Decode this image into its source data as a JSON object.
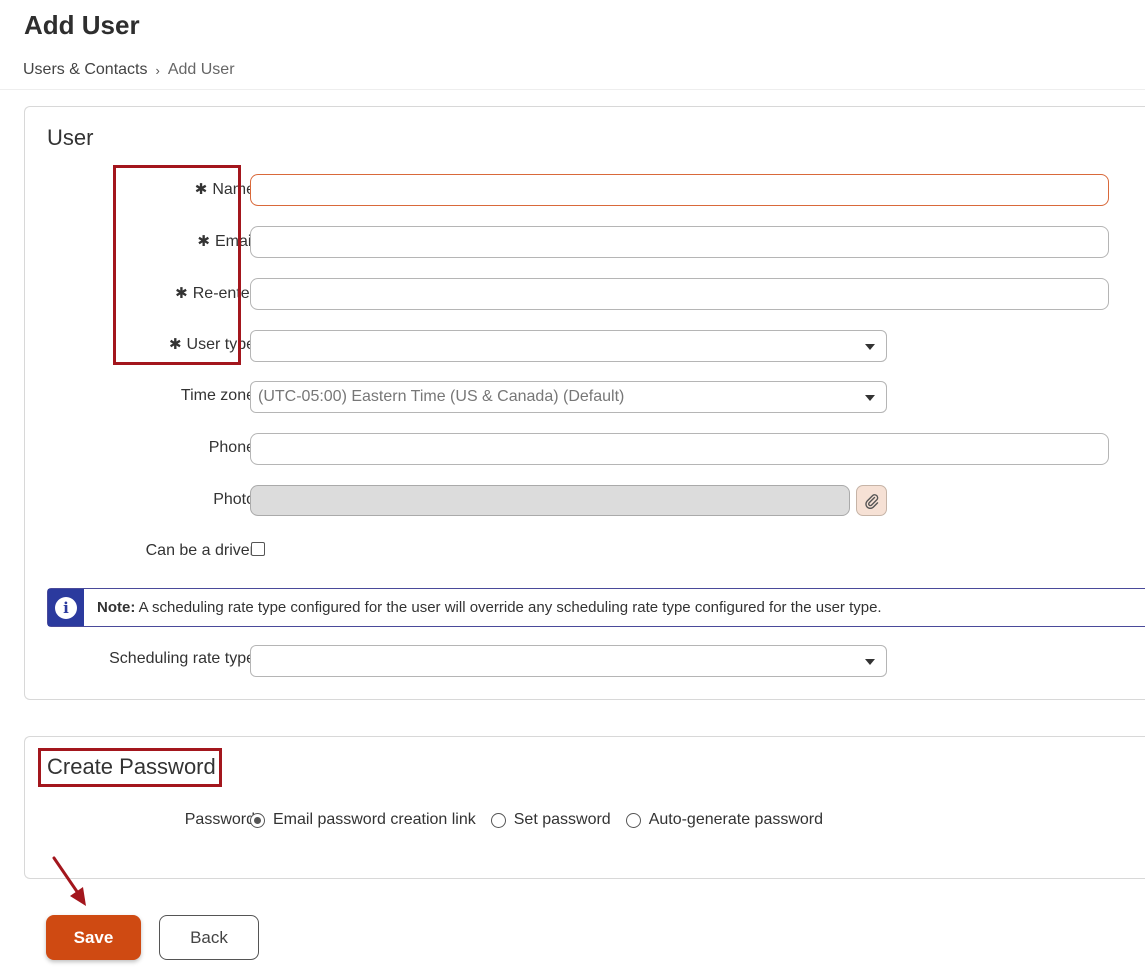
{
  "page": {
    "title": "Add User",
    "breadcrumb": {
      "parent": "Users & Contacts",
      "separator": "›",
      "current": "Add User"
    }
  },
  "user_section": {
    "title": "User",
    "required_mark": "✱",
    "fields": {
      "name": {
        "label": "Name",
        "value": "",
        "required": true
      },
      "email": {
        "label": "Email",
        "value": "",
        "required": true
      },
      "reenter": {
        "label": "Re-enter",
        "value": "",
        "required": true
      },
      "user_type": {
        "label": "User type",
        "value": "",
        "required": true
      },
      "time_zone": {
        "label": "Time zone",
        "value": "(UTC-05:00) Eastern Time (US & Canada) (Default)"
      },
      "phone": {
        "label": "Phone",
        "value": ""
      },
      "photo": {
        "label": "Photo",
        "value": ""
      },
      "driver": {
        "label": "Can be a driver",
        "checked": false
      },
      "scheduling_rate_type": {
        "label": "Scheduling rate type",
        "value": ""
      }
    },
    "note": {
      "prefix": "Note:",
      "text": "A scheduling rate type configured for the user will override any scheduling rate type configured for the user type."
    }
  },
  "password_section": {
    "title": "Create Password",
    "label": "Password",
    "options": [
      {
        "label": "Email password creation link",
        "checked": true
      },
      {
        "label": "Set password",
        "checked": false
      },
      {
        "label": "Auto-generate password",
        "checked": false
      }
    ]
  },
  "actions": {
    "save_label": "Save",
    "back_label": "Back"
  },
  "icons": {
    "info": "info-icon",
    "attach": "paperclip-icon",
    "dropdown": "chevron-down-icon",
    "arrow": "annotation-arrow-icon"
  },
  "colors": {
    "primary": "#cf4a12",
    "highlight": "#a3161d",
    "info": "#2b3a9e",
    "error_border": "#d9693a"
  }
}
